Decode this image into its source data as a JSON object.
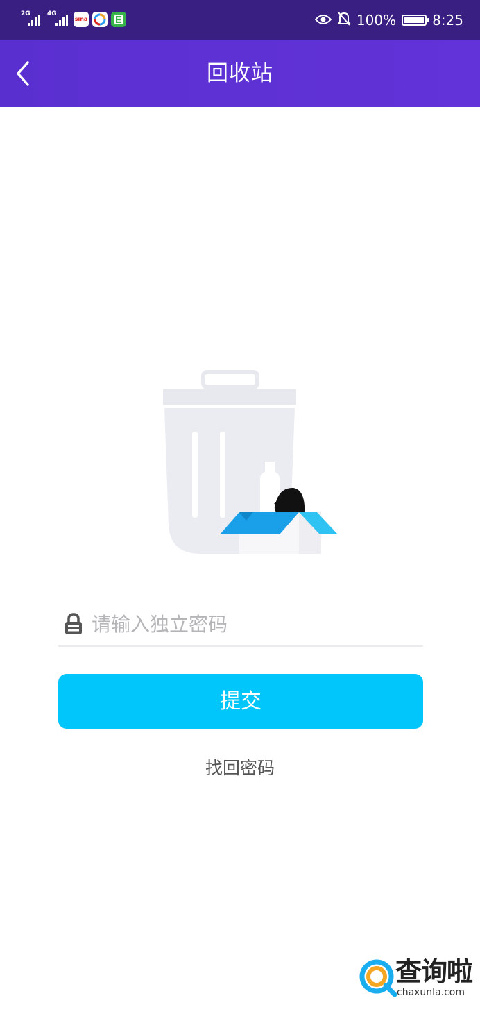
{
  "status_bar": {
    "signal_1": "2G",
    "signal_2": "4G",
    "app_icons": [
      "sina-app-icon",
      "browser-app-icon",
      "green-app-icon"
    ],
    "battery": "100%",
    "time": "8:25"
  },
  "nav": {
    "title": "回收站",
    "back_icon": "chevron-left-icon"
  },
  "form": {
    "password_placeholder": "请输入独立密码",
    "password_value": "",
    "submit_label": "提交",
    "forgot_label": "找回密码"
  },
  "watermark": {
    "brand": "查询啦",
    "url": "chaxunla.com"
  },
  "colors": {
    "status_bar": "#3a1f82",
    "nav_bar": "#5e31d4",
    "submit_button": "#00c6fb",
    "accent_blue": "#1aaef0",
    "watermark_orange": "#f5a623"
  }
}
